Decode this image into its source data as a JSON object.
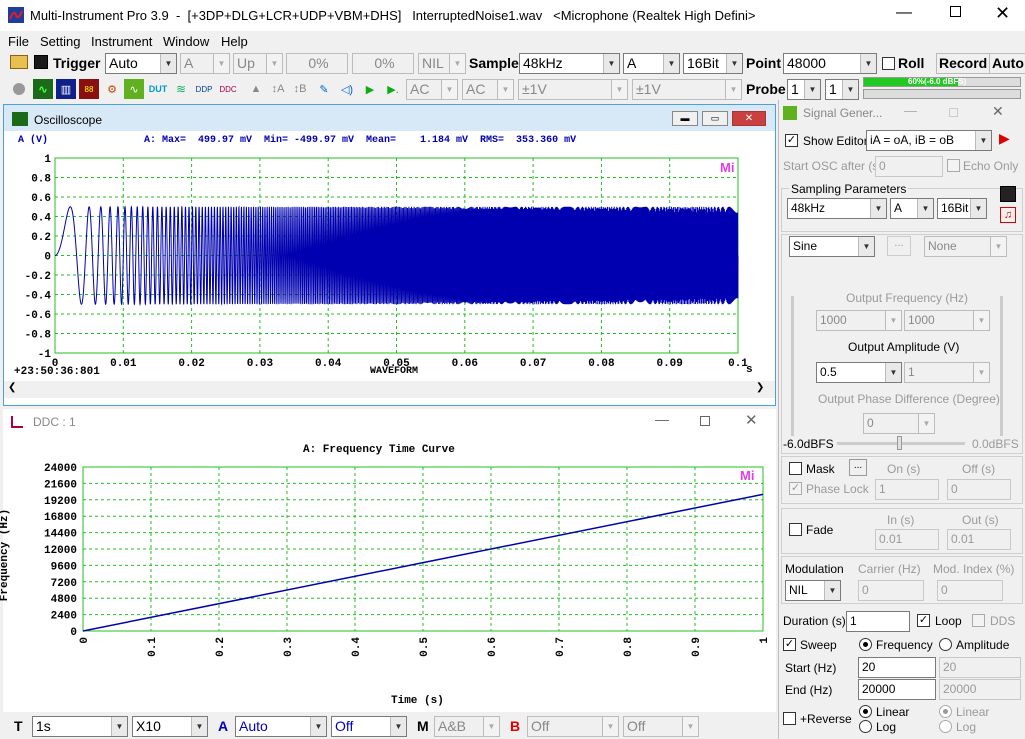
{
  "app": {
    "title": "Multi-Instrument Pro 3.9  -  [+3DP+DLG+LCR+UDP+VBM+DHS]   InterruptedNoise1.wav   <Microphone (Realtek High Defini>"
  },
  "menu": [
    "File",
    "Setting",
    "Instrument",
    "Window",
    "Help"
  ],
  "toolbar1": {
    "trigger_label": "Trigger",
    "trigger_mode": "Auto",
    "trigger_channel": "A",
    "trigger_edge": "Up",
    "pct1": "0%",
    "pct2": "0%",
    "nil": "NIL",
    "sample_label": "Sample",
    "sample_rate": "48kHz",
    "channel": "A",
    "bits": "16Bit",
    "point_label": "Point",
    "points": "48000",
    "roll": "Roll",
    "record": "Record",
    "auto": "Auto"
  },
  "toolbar2": {
    "coupling_a": "AC",
    "coupling_b": "AC",
    "range_a": "±1V",
    "range_b": "±1V",
    "probe_label": "Probe",
    "probe_a": "1",
    "probe_b": "1",
    "level_text": "60%(-6.0 dBFS)"
  },
  "oscilloscope": {
    "title": "Oscilloscope",
    "channel_label": "A (V)",
    "stats": "A: Max=  499.97 mV  Min= -499.97 mV  Mean=    1.184 mV  RMS=  353.360 mV",
    "y_ticks": [
      "1",
      "0.8",
      "0.6",
      "0.4",
      "0.2",
      "0",
      "-0.2",
      "-0.4",
      "-0.6",
      "-0.8",
      "-1"
    ],
    "x_ticks": [
      "0",
      "0.01",
      "0.02",
      "0.03",
      "0.04",
      "0.05",
      "0.06",
      "0.07",
      "0.08",
      "0.09",
      "0.1"
    ],
    "x_unit": "s",
    "timestamp": "+23:50:36:801",
    "xlabel": "WAVEFORM",
    "logo": "Mi"
  },
  "ddc": {
    "title": "DDC : 1",
    "chart_title": "A: Frequency Time Curve",
    "ylabel": "Frequency (Hz)",
    "xlabel": "Time (s)",
    "y_ticks": [
      "24000",
      "21600",
      "19200",
      "16800",
      "14400",
      "12000",
      "9600",
      "7200",
      "4800",
      "2400",
      "0"
    ],
    "x_ticks": [
      "0",
      "0.1",
      "0.2",
      "0.3",
      "0.4",
      "0.5",
      "0.6",
      "0.7",
      "0.8",
      "0.9",
      "1"
    ],
    "logo": "Mi"
  },
  "chart_data": {
    "type": "line",
    "title": "A: Frequency Time Curve",
    "xlabel": "Time (s)",
    "ylabel": "Frequency (Hz)",
    "x": [
      0,
      0.5,
      1
    ],
    "series": [
      {
        "values": [
          0,
          10000,
          20000
        ]
      }
    ],
    "xlim": [
      0,
      1
    ],
    "ylim": [
      0,
      24000
    ],
    "grid": true
  },
  "siggen": {
    "title": "Signal Gener...",
    "show_editor": "Show Editor",
    "editor_expr": "iA = oA, iB = oB",
    "start_osc_label": "Start OSC after (s)",
    "start_osc_value": "0",
    "echo_only": "Echo Only",
    "sampling_params": "Sampling Parameters",
    "rate": "48kHz",
    "channel": "A",
    "bits": "16Bit",
    "waveform": "Sine",
    "none": "None",
    "dots": "...",
    "out_freq_label": "Output Frequency (Hz)",
    "freq1": "1000",
    "freq2": "1000",
    "out_amp_label": "Output Amplitude (V)",
    "amp1": "0.5",
    "amp2": "1",
    "phase_label": "Output Phase Difference (Degree)",
    "phase": "0",
    "db_min": "-6.0dBFS",
    "db_max": "0.0dBFS",
    "mask": "Mask",
    "on_label": "On (s)",
    "off_label": "Off (s)",
    "phase_lock": "Phase Lock",
    "on_val": "1",
    "off_val": "0",
    "fade": "Fade",
    "in_label": "In (s)",
    "out_label": "Out (s)",
    "in_val": "0.01",
    "out_val": "0.01",
    "modulation": "Modulation",
    "carrier_label": "Carrier (Hz)",
    "mod_index_label": "Mod. Index (%)",
    "mod_value": "NIL",
    "carrier_val": "0",
    "mod_index_val": "0",
    "duration_label": "Duration (s)",
    "duration_val": "1",
    "loop": "Loop",
    "dds": "DDS",
    "sweep": "Sweep",
    "frequency": "Frequency",
    "amplitude": "Amplitude",
    "start_label": "Start (Hz)",
    "start_val": "20",
    "start_val2": "20",
    "end_label": "End (Hz)",
    "end_val": "20000",
    "end_val2": "20000",
    "reverse": "+Reverse",
    "linear": "Linear",
    "log": "Log",
    "linear2": "Linear",
    "log2": "Log"
  },
  "bottombar": {
    "t_label": "T",
    "t_value": "1s",
    "zoom": "X10",
    "a_label": "A",
    "a_value": "Auto",
    "a_off": "Off",
    "m_label": "M",
    "m_value": "A&B",
    "b_label": "B",
    "b_value": "Off",
    "b_off": "Off"
  }
}
